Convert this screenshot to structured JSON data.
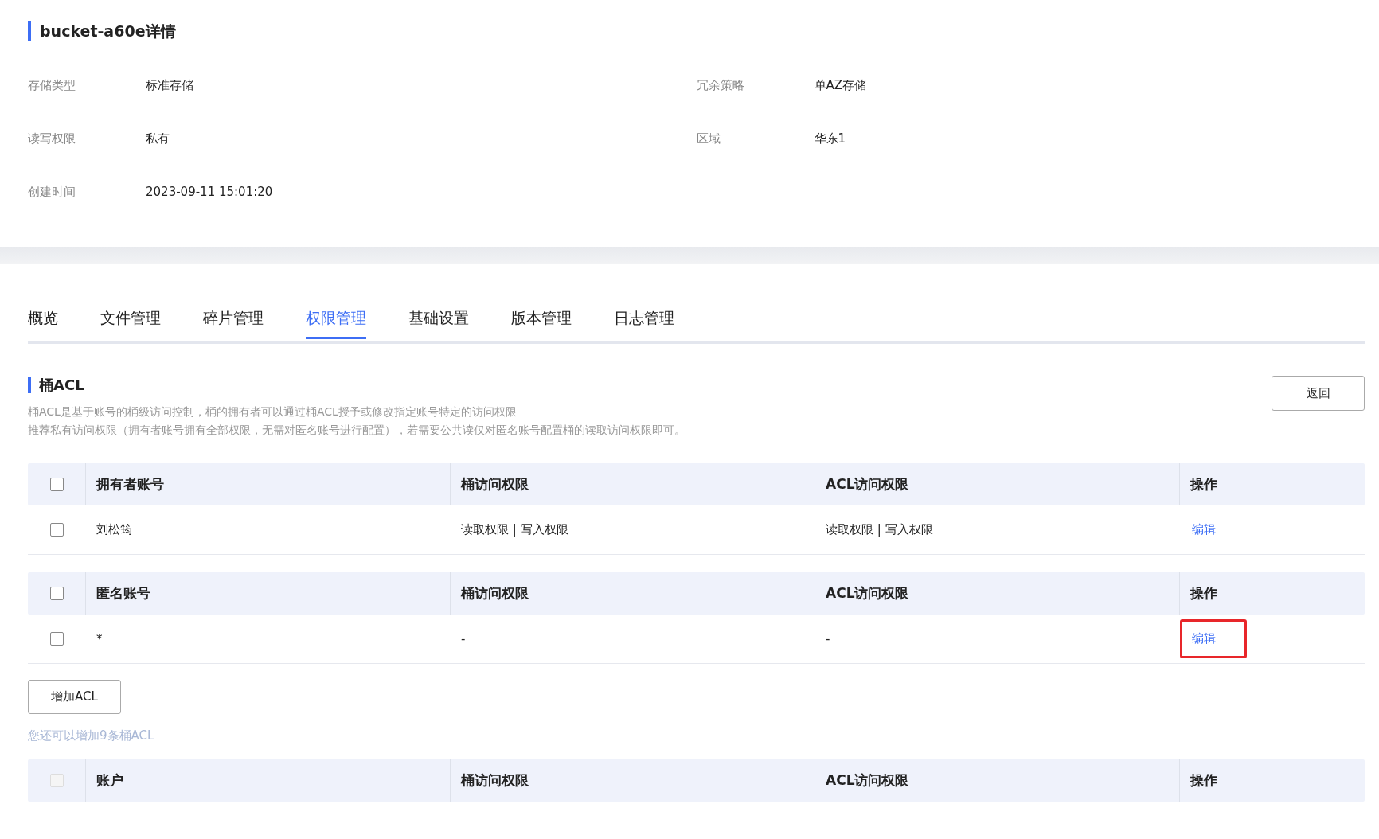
{
  "title": "bucket-a60e详情",
  "info": [
    {
      "label": "存储类型",
      "value": "标准存储"
    },
    {
      "label": "冗余策略",
      "value": "单AZ存储"
    },
    {
      "label": "读写权限",
      "value": "私有"
    },
    {
      "label": "区域",
      "value": "华东1"
    },
    {
      "label": "创建时间",
      "value": "2023-09-11 15:01:20"
    }
  ],
  "tabs": [
    {
      "label": "概览",
      "selected": false
    },
    {
      "label": "文件管理",
      "selected": false
    },
    {
      "label": "碎片管理",
      "selected": false
    },
    {
      "label": "权限管理",
      "selected": true
    },
    {
      "label": "基础设置",
      "selected": false
    },
    {
      "label": "版本管理",
      "selected": false
    },
    {
      "label": "日志管理",
      "selected": false
    }
  ],
  "acl": {
    "title": "桶ACL",
    "description": [
      "桶ACL是基于账号的桶级访问控制，桶的拥有者可以通过桶ACL授予或修改指定账号特定的访问权限",
      "推荐私有访问权限（拥有者账号拥有全部权限，无需对匿名账号进行配置），若需要公共读仅对匿名账号配置桶的读取访问权限即可。"
    ],
    "back_button": "返回"
  },
  "tables": [
    {
      "header": {
        "checked": false,
        "disabled": false,
        "columns": [
          "拥有者账号",
          "桶访问权限",
          "ACL访问权限",
          "操作"
        ]
      },
      "rows": [
        {
          "checked": false,
          "cells": [
            "刘松筠",
            "读取权限 | 写入权限",
            "读取权限 | 写入权限"
          ],
          "action": "编辑",
          "highlighted": false
        }
      ]
    },
    {
      "header": {
        "checked": false,
        "disabled": false,
        "columns": [
          "匿名账号",
          "桶访问权限",
          "ACL访问权限",
          "操作"
        ]
      },
      "rows": [
        {
          "checked": false,
          "cells": [
            "*",
            "-",
            "-"
          ],
          "action": "编辑",
          "highlighted": true
        }
      ]
    }
  ],
  "add_button": "增加ACL",
  "add_hint": "您还可以增加9条桶ACL",
  "acl_table": {
    "header": {
      "checked": false,
      "disabled": true,
      "columns": [
        "账户",
        "桶访问权限",
        "ACL访问权限",
        "操作"
      ]
    }
  }
}
